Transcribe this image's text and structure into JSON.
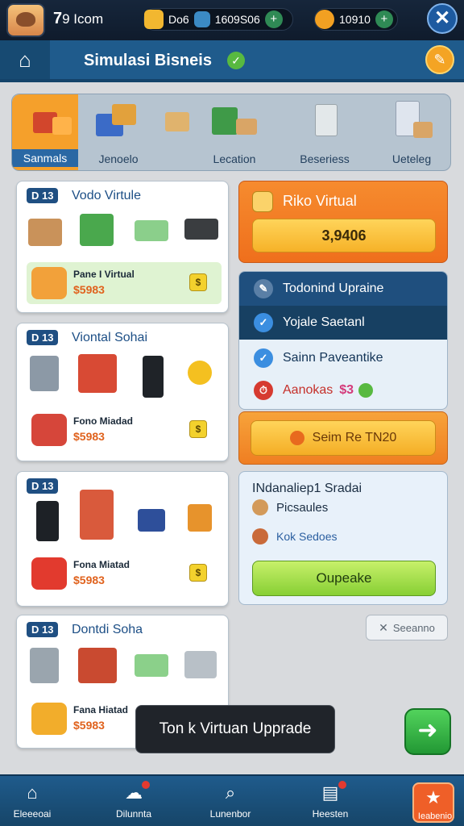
{
  "topbar": {
    "level": "7",
    "level_label": "9 Icom",
    "currency1": {
      "icon": "coin-icon",
      "label": "Dο6",
      "value": "1609S06"
    },
    "currency2": {
      "icon": "gold-coin-icon",
      "value": "10910"
    }
  },
  "header": {
    "title": "Simulasi Bisneis"
  },
  "tabs": [
    {
      "label": "Sanmals",
      "active": true
    },
    {
      "label": "Jenoelo"
    },
    {
      "label": "Lecation"
    },
    {
      "label": "Beseriess"
    },
    {
      "label": "Ueteleg"
    }
  ],
  "cards": [
    {
      "badge": "D 13",
      "title": "Vodo Virtule",
      "promo_title": "Pane I Virtual",
      "promo_price": "$5983",
      "promo_btn": "$"
    },
    {
      "badge": "D 13",
      "title": "Viontal Sohai",
      "promo_title": "Fono Miadad",
      "promo_price": "$5983",
      "promo_btn": "$"
    },
    {
      "badge": "D 13",
      "title": "",
      "promo_title": "Fona Miatad",
      "promo_price": "$5983",
      "promo_btn": "$"
    },
    {
      "badge": "D 13",
      "title": "Dontdi Soha",
      "promo_title": "Fana Hiatad",
      "promo_price": "$5983",
      "promo_btn": ""
    }
  ],
  "risk": {
    "title": "Riko Virtual",
    "value": "3,9406"
  },
  "tasks": [
    {
      "label": "Todonind Upraine",
      "icon": "pencil-icon"
    },
    {
      "label": "Yojale Saetanl",
      "icon": "check-icon"
    },
    {
      "label": "Sainn Paveantike",
      "icon": "check-icon"
    },
    {
      "label": "Aanokas",
      "extra": "$3",
      "icon": "clock-icon"
    }
  ],
  "speed_button": {
    "label": "Seim Re TN20"
  },
  "upgrade": {
    "title": "INdanaliep1 Sradai",
    "row1": "Picsaules",
    "row2": "Kok Sedoes",
    "button": "Oupeake"
  },
  "search_button": {
    "label": "Seeanno"
  },
  "toast": {
    "text": "Ton k Virtuan Upprade"
  },
  "bottom_nav": [
    {
      "label": "Eleeeoai",
      "icon": "home-icon"
    },
    {
      "label": "Dilunnta",
      "icon": "chat-icon"
    },
    {
      "label": "Lunenbor",
      "icon": "search-icon"
    },
    {
      "label": "Heesten",
      "icon": "calendar-icon"
    },
    {
      "label": "Ieabenio",
      "icon": "star-icon"
    }
  ],
  "colors": {
    "header_blue": "#1f5b8c",
    "accent_orange": "#ef6f1c",
    "accent_yellow": "#f6b228",
    "accent_green": "#87cf34",
    "price_orange": "#e0621d"
  }
}
